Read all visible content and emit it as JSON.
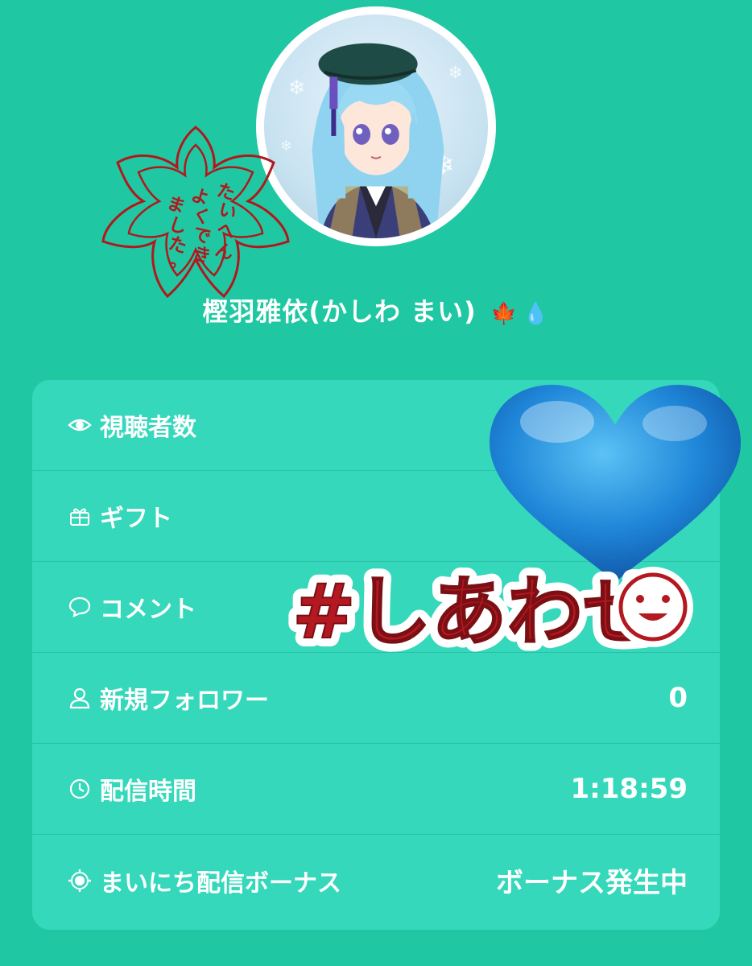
{
  "profile": {
    "display_name": "樫羽雅依(かしわ まい)",
    "name_emoji_maple": "🍁",
    "name_emoji_drop": "💧",
    "avatar_icon": "avatar-anime-character"
  },
  "stats": [
    {
      "icon": "eye-icon",
      "label": "視聴者数",
      "value": ""
    },
    {
      "icon": "gift-icon",
      "label": "ギフト",
      "value": ""
    },
    {
      "icon": "comment-icon",
      "label": "コメント",
      "value": ""
    },
    {
      "icon": "user-icon",
      "label": "新規フォロワー",
      "value": "0"
    },
    {
      "icon": "clock-icon",
      "label": "配信時間",
      "value": "1:18:59"
    },
    {
      "icon": "sun-icon",
      "label": "まいにち配信ボーナス",
      "value": "ボーナス発生中"
    }
  ],
  "stickers": {
    "sakura_stamp_text": "たいへんよくできました。",
    "hashtag_text": "#しあわせ",
    "heart": "blue-heart"
  },
  "colors": {
    "background": "#1fc8a2",
    "card": "#35d8bb",
    "stamp": "#b0181d",
    "heart": "#1f86d8"
  }
}
